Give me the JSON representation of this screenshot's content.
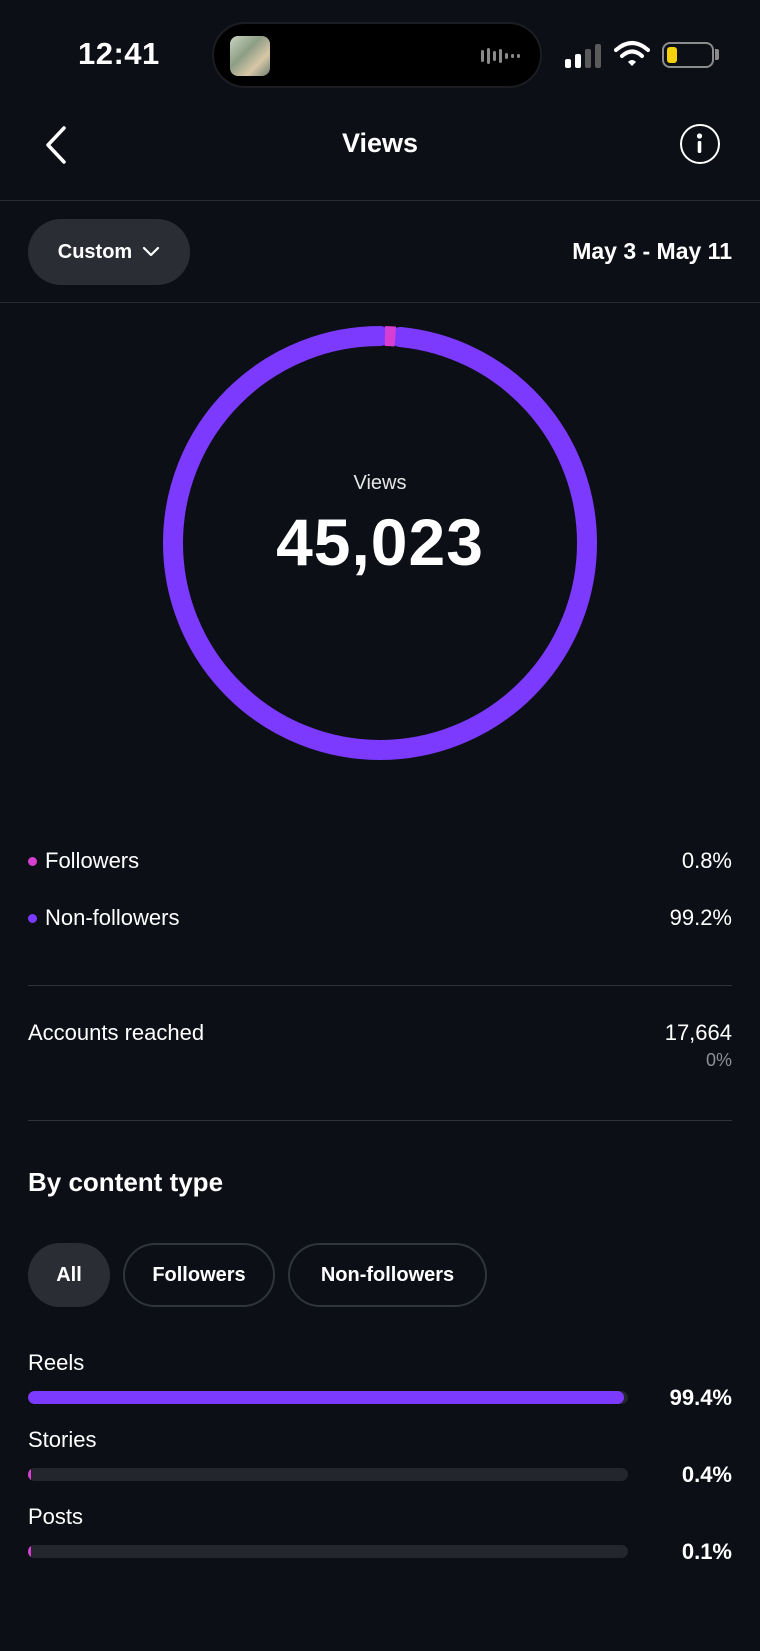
{
  "status_bar": {
    "time": "12:41"
  },
  "header": {
    "title": "Views",
    "back_icon": "chevron-left-icon",
    "info_icon": "info-icon"
  },
  "filter": {
    "range_label": "Custom",
    "date_range": "May 3 - May 11"
  },
  "summary": {
    "label": "Views",
    "value": "45,023"
  },
  "audience": {
    "followers": {
      "label": "Followers",
      "value": "0.8%",
      "fraction": 0.008,
      "color": "#d63fd1"
    },
    "non_followers": {
      "label": "Non-followers",
      "value": "99.2%",
      "fraction": 0.992,
      "color": "#7c3aff"
    }
  },
  "accounts_reached": {
    "label": "Accounts reached",
    "value": "17,664",
    "change": "0%"
  },
  "by_content_type": {
    "title": "By content type",
    "chips": [
      {
        "label": "All",
        "active": true
      },
      {
        "label": "Followers",
        "active": false
      },
      {
        "label": "Non-followers",
        "active": false
      }
    ],
    "rows": [
      {
        "label": "Reels",
        "value": "99.4%",
        "fraction": 0.994
      },
      {
        "label": "Stories",
        "value": "0.4%",
        "fraction": 0.004
      },
      {
        "label": "Posts",
        "value": "0.1%",
        "fraction": 0.001
      }
    ]
  },
  "colors": {
    "accent_purple": "#7c3aff",
    "accent_pink": "#d63fd1",
    "background": "#0c0f16"
  }
}
